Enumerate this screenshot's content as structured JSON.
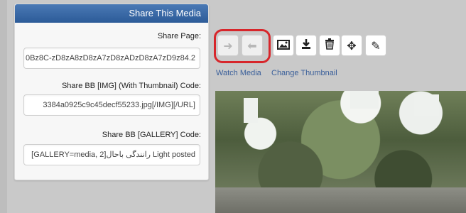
{
  "panel": {
    "title": "Share This Media",
    "share_page": {
      "label": "Share Page:",
      "value": "0Bz8C-zD8zA8zD8zA7zD8zADzD8zA7zD9z84.2"
    },
    "share_bb_img": {
      "label": "Share BB [IMG] (With Thumbnail) Code:",
      "value": "3384a0925c9c45decf55233.jpg[/IMG][/URL]"
    },
    "share_bb_gallery": {
      "label": "Share BB [GALLERY] Code:",
      "value": "[GALLERY=media, 2]رانندگی باحال Light posted"
    }
  },
  "toolbar": {
    "next_icon": "arrow-right-icon",
    "prev_icon": "arrow-left-icon",
    "image_icon": "image-icon",
    "download_icon": "download-icon",
    "delete_icon": "trash-icon",
    "move_icon": "move-arrows-icon",
    "edit_icon": "pencil-icon"
  },
  "links": {
    "watch_media": "Watch Media",
    "change_thumbnail": "Change Thumbnail"
  },
  "colors": {
    "header_blue": "#2c5b98",
    "highlight_red": "#d7262b",
    "link_blue": "#3a5f9a"
  }
}
